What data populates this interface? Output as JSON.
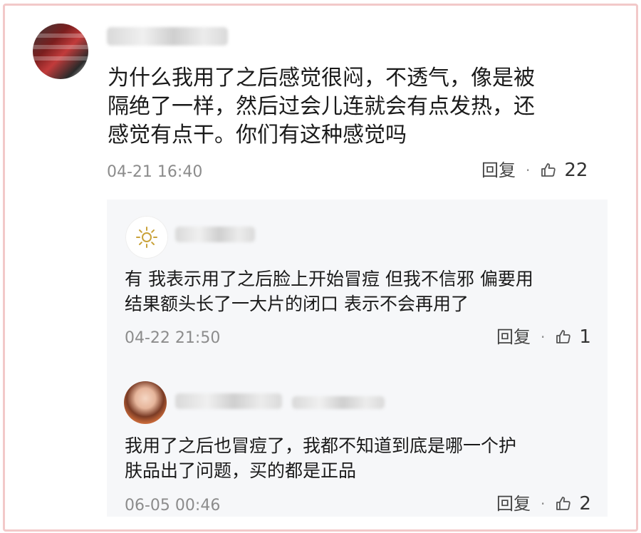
{
  "main_comment": {
    "text_lines": [
      "为什么我用了之后感觉很闷，不透气，像是被",
      "隔绝了一样，然后过会儿连就会有点发热，还",
      "感觉有点干。你们有这种感觉吗"
    ],
    "time": "04-21 16:40",
    "reply_label": "回复",
    "separator": "·",
    "likes": "22"
  },
  "replies": [
    {
      "avatar_icon": "sun-icon",
      "text_lines": [
        "有 我表示用了之后脸上开始冒痘 但我不信邪 偏要用",
        "结果额头长了一大片的闭口 表示不会再用了"
      ],
      "time": "04-22 21:50",
      "reply_label": "回复",
      "separator": "·",
      "likes": "1"
    },
    {
      "avatar_icon": "user-photo",
      "text_lines": [
        "我用了之后也冒痘了，我都不知道到底是哪一个护",
        "肤品出了问题，买的都是正品"
      ],
      "time": "06-05 00:46",
      "reply_label": "回复",
      "separator": "·",
      "likes": "2"
    }
  ],
  "colors": {
    "frame_border": "#f2c9c9",
    "reply_background": "#f6f7f9",
    "meta_text": "#8c8c8c"
  }
}
